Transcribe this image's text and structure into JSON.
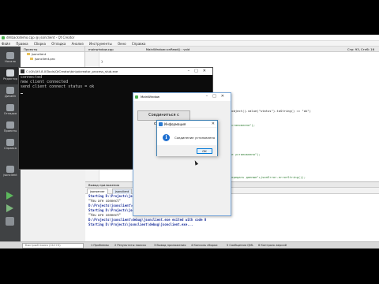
{
  "window_title": "dmbackdemo.cpp @ jsonclient - Qt Creator",
  "menu": [
    "Файл",
    "Правка",
    "Сборка",
    "Отладка",
    "Анализ",
    "Инструменты",
    "Окно",
    "Справка"
  ],
  "modes": [
    "Начало",
    "Редактор",
    "Дизайн",
    "Отладка",
    "Проекты",
    "Справка"
  ],
  "kit_label": "jsonclient",
  "projects_title": "Проекты",
  "project_tree": [
    "jsonclient",
    "jsonclient.pro"
  ],
  "editor_tab": "mainwindow.cpp",
  "editor_tab2": "MainWindow::onRead() : void",
  "position": "Стр: 93, Стлб: 16",
  "code_lines": [
    {
      "text": "}",
      "cls": ""
    },
    {
      "text": ".object().value(\"status\").toString() == \"ok\")",
      "cls": ""
    },
    {
      "text": "установлено\");",
      "cls": "str"
    },
    {
      "text": "не установлено\");",
      "cls": "str"
    },
    {
      "text": "передать данные\"+jsonError.errorString());",
      "cls": "str"
    }
  ],
  "console": {
    "title": "C:\\Qt\\Qt5.8.0\\Tools\\QtCreator\\bin\\qtcreator_process_stub.exe",
    "lines": [
      "connected",
      "new client connected",
      "send client connect status = ok"
    ]
  },
  "main_window": {
    "title": "MainWindow",
    "connect_button": "Соединиться с сервером"
  },
  "info_dialog": {
    "title": "Информация",
    "message": "Соединение установлено",
    "ok": "OK",
    "icon": "i"
  },
  "output": {
    "header": "Вывод приложения",
    "tabs": [
      "jsonserver",
      "jsonclient"
    ],
    "lines": [
      {
        "text": "Starting D:\\Projects\\jsonclient\\debug\\jsonclient.exe...",
        "cls": "b"
      },
      {
        "text": "\"You are connect\"",
        "cls": ""
      },
      {
        "text": "D:\\Projects\\jsonclient\\debug\\jsonclient.exe exited with code 0",
        "cls": "b"
      },
      {
        "text": "",
        "cls": ""
      },
      {
        "text": "Starting D:\\Projects\\jsonclient\\debug\\jsonclient.exe...",
        "cls": "b"
      },
      {
        "text": "\"You are connect\"",
        "cls": ""
      },
      {
        "text": "D:\\Projects\\jsonclient\\debug\\jsonclient.exe exited with code 0",
        "cls": "b"
      },
      {
        "text": "",
        "cls": ""
      },
      {
        "text": "Starting D:\\Projects\\jsonclient\\debug\\jsonclient.exe...",
        "cls": "b"
      }
    ]
  },
  "status": {
    "locate_placeholder": "Быстрый поиск (Ctrl+K)",
    "tabs": [
      "1 Проблемы",
      "2 Результаты поиска",
      "3 Вывод приложения",
      "4 Консоль сборки",
      "5 Сообщения QML",
      "6 Контроль версий"
    ]
  },
  "colors": {
    "accent": "#5cb85c",
    "console_bg": "#0c0c0c",
    "dialog_border": "#3c7fb1"
  }
}
